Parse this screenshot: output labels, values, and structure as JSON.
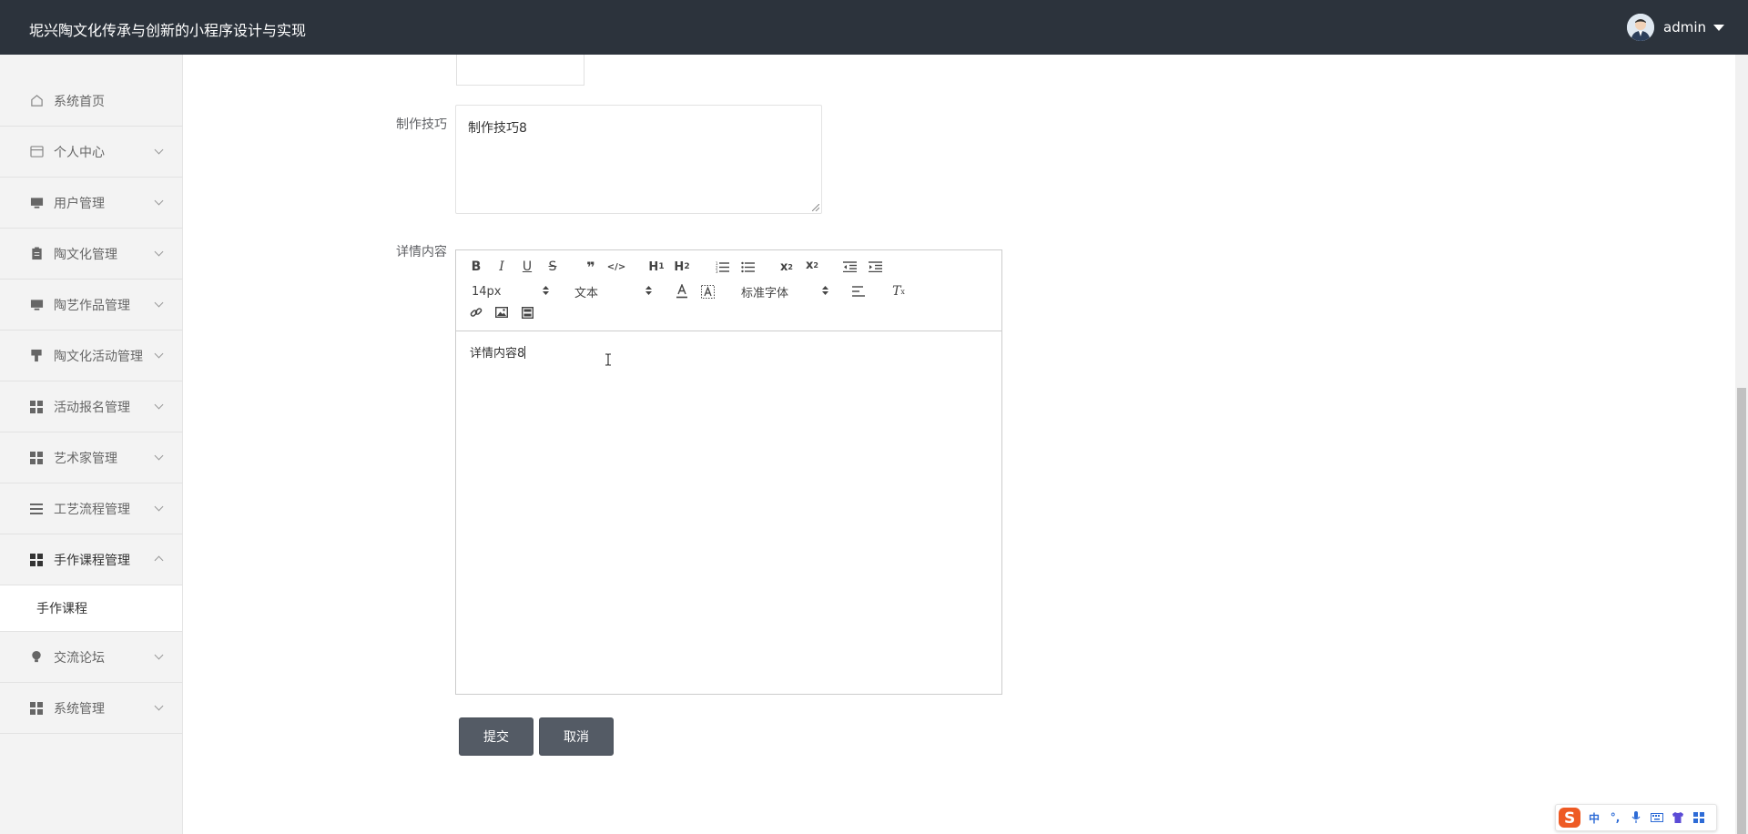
{
  "header": {
    "app_title": "坭兴陶文化传承与创新的小程序设计与实现",
    "username": "admin"
  },
  "sidebar": {
    "items": [
      {
        "label": "系统首页",
        "icon": "home-icon"
      },
      {
        "label": "个人中心",
        "icon": "card-icon"
      },
      {
        "label": "用户管理",
        "icon": "monitor-icon"
      },
      {
        "label": "陶文化管理",
        "icon": "clipboard-icon"
      },
      {
        "label": "陶艺作品管理",
        "icon": "monitor-icon"
      },
      {
        "label": "陶文化活动管理",
        "icon": "brush-icon"
      },
      {
        "label": "活动报名管理",
        "icon": "grid-icon"
      },
      {
        "label": "艺术家管理",
        "icon": "grid-icon"
      },
      {
        "label": "工艺流程管理",
        "icon": "list-icon"
      },
      {
        "label": "手作课程管理",
        "icon": "grid-icon"
      },
      {
        "label": "交流论坛",
        "icon": "bulb-icon"
      },
      {
        "label": "系统管理",
        "icon": "grid-icon"
      }
    ],
    "submenu": {
      "label": "手作课程"
    }
  },
  "form": {
    "skill_label": "制作技巧",
    "skill_value": "制作技巧8",
    "detail_label": "详情内容",
    "detail_value": "详情内容8",
    "submit_label": "提交",
    "cancel_label": "取消"
  },
  "editor": {
    "font_size": "14px",
    "text_type": "文本",
    "font_family": "标准字体",
    "toolbar_buttons": [
      "bold",
      "italic",
      "underline",
      "strike",
      "blockquote",
      "code-block",
      "header-1",
      "header-2",
      "ordered-list",
      "bullet-list",
      "subscript",
      "superscript",
      "outdent",
      "indent",
      "font-color",
      "background-color",
      "align",
      "clean",
      "link",
      "image",
      "video"
    ]
  },
  "ime": {
    "mode": "中",
    "punct": "°,"
  }
}
